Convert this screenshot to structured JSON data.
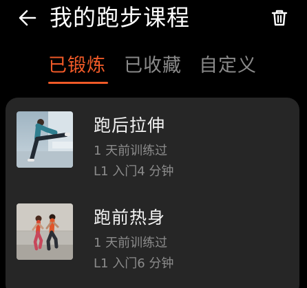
{
  "header": {
    "title": "我的跑步课程",
    "back_icon": "arrow-left-icon",
    "delete_icon": "trash-icon"
  },
  "tabs": [
    {
      "label": "已锻炼",
      "active": true
    },
    {
      "label": "已收藏",
      "active": false
    },
    {
      "label": "自定义",
      "active": false
    }
  ],
  "colors": {
    "accent": "#f05a28",
    "background": "#000000",
    "card": "#262626",
    "muted_text": "#8c8c8c"
  },
  "courses": [
    {
      "name": "跑后拉伸",
      "last_trained": "1 天前训练过",
      "level_duration": "L1 入门4 分钟"
    },
    {
      "name": "跑前热身",
      "last_trained": "1 天前训练过",
      "level_duration": "L1 入门6 分钟"
    }
  ]
}
